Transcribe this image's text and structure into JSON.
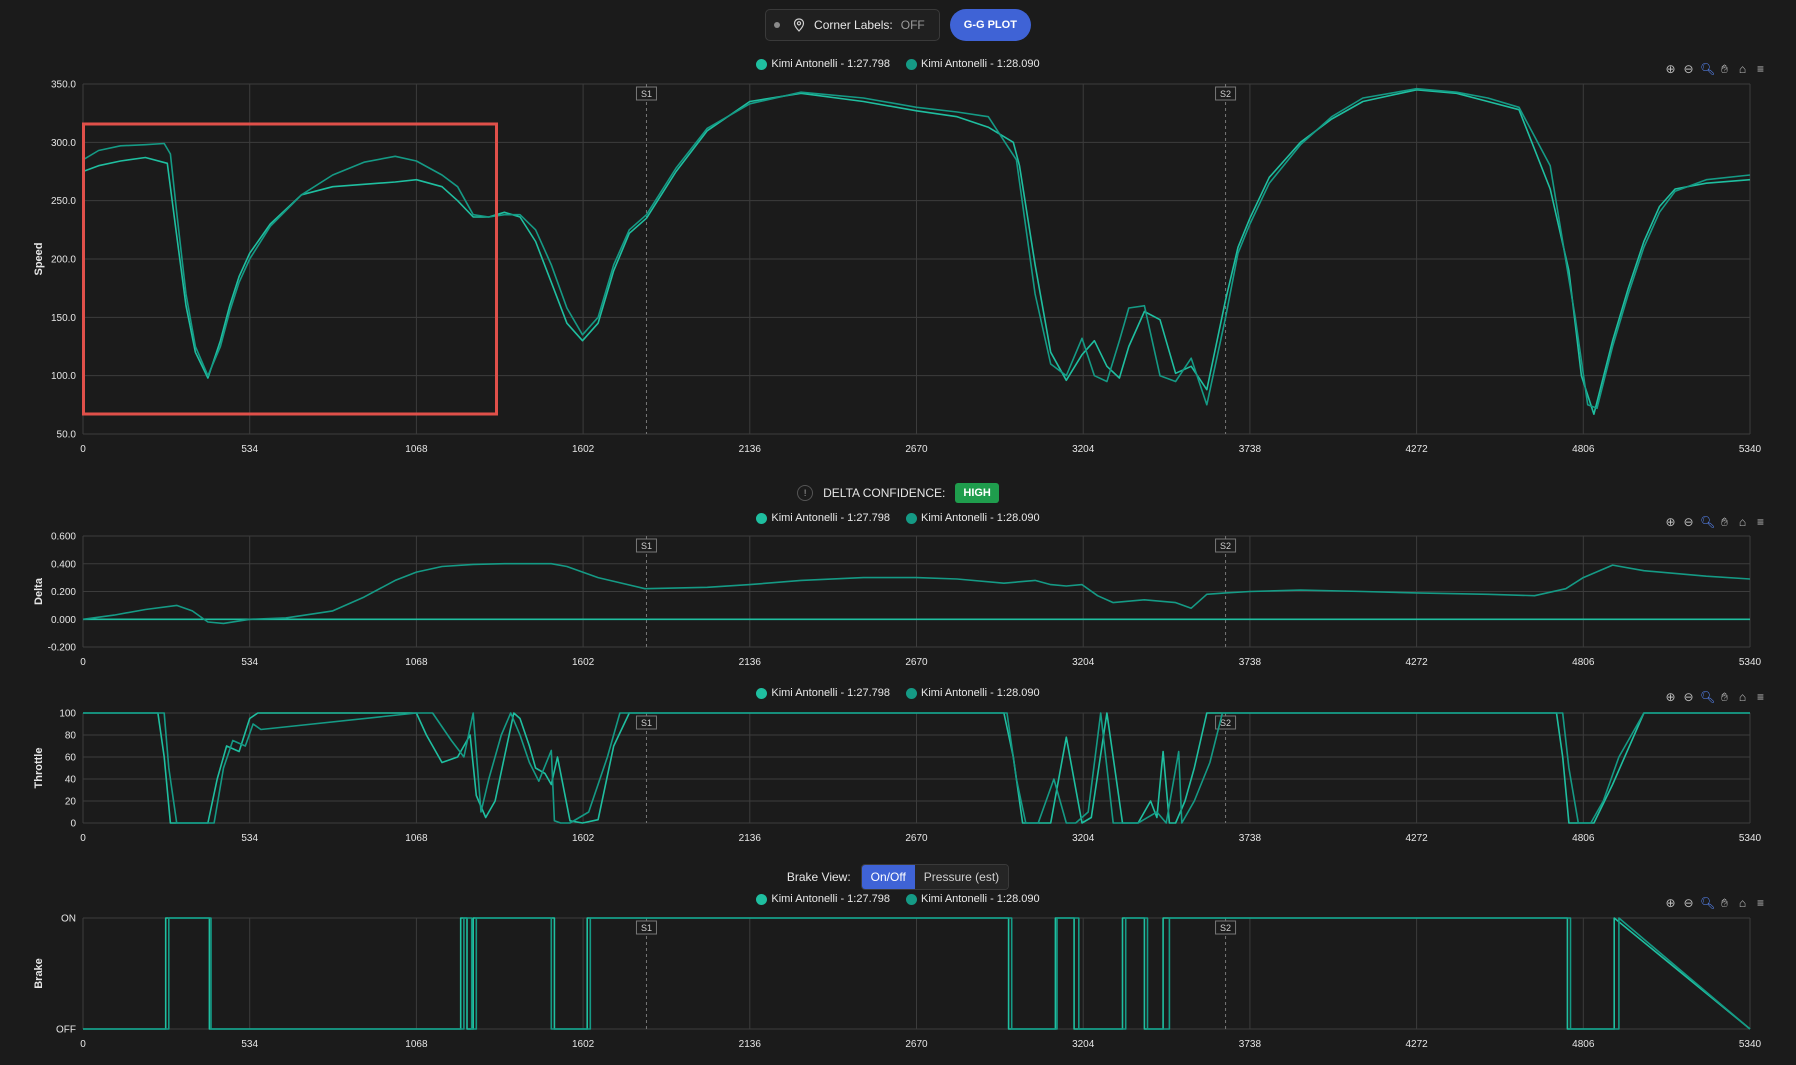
{
  "top_bar": {
    "corner_labels_text": "Corner Labels:",
    "corner_labels_state": "OFF",
    "gg_plot_label": "G-G PLOT"
  },
  "delta_confidence": {
    "label": "DELTA CONFIDENCE:",
    "value": "HIGH"
  },
  "brake_view": {
    "label": "Brake View:",
    "options": [
      "On/Off",
      "Pressure (est)"
    ],
    "selected": "On/Off"
  },
  "colors": {
    "background": "#1b1b1b",
    "series_a": "#1fbfa0",
    "series_b": "#159a85",
    "grid": "#3c3c3c",
    "accent": "#3f63d6",
    "highlight_box": "#e0504a",
    "high_badge": "#1f9d4d"
  },
  "toolbar_icons": [
    "zoom-in-icon",
    "zoom-out-icon",
    "magnifier-icon",
    "pan-hand-icon",
    "home-icon",
    "menu-icon"
  ],
  "chart_data": [
    {
      "type": "line",
      "ylabel": "Speed",
      "ylim": [
        50,
        350
      ],
      "yticks": [
        "50.0",
        "100.0",
        "150.0",
        "200.0",
        "250.0",
        "300.0",
        "350.0"
      ],
      "xticks": [
        "0",
        "534",
        "1068",
        "1602",
        "2136",
        "2670",
        "3204",
        "3738",
        "4272",
        "4806",
        "5340"
      ],
      "xlim": [
        0,
        5340
      ],
      "sectors": [
        {
          "label": "S1",
          "x": 1805
        },
        {
          "label": "S2",
          "x": 3660
        }
      ],
      "legend": [
        "Kimi Antonelli - 1:27.798",
        "Kimi Antonelli - 1:28.090"
      ],
      "series": [
        {
          "name": "Kimi Antonelli - 1:27.798",
          "x": [
            0,
            50,
            120,
            200,
            270,
            300,
            330,
            360,
            400,
            440,
            470,
            500,
            534,
            600,
            700,
            800,
            900,
            1000,
            1068,
            1150,
            1200,
            1250,
            1300,
            1350,
            1400,
            1450,
            1500,
            1550,
            1600,
            1650,
            1700,
            1750,
            1805,
            1900,
            2000,
            2136,
            2300,
            2500,
            2670,
            2800,
            2900,
            2980,
            3000,
            3050,
            3100,
            3150,
            3200,
            3240,
            3280,
            3320,
            3350,
            3400,
            3450,
            3500,
            3550,
            3600,
            3660,
            3700,
            3738,
            3800,
            3900,
            4000,
            4100,
            4272,
            4400,
            4500,
            4600,
            4700,
            4760,
            4800,
            4840,
            4900,
            4950,
            5000,
            5050,
            5100,
            5200,
            5340
          ],
          "y": [
            275,
            280,
            284,
            287,
            282,
            220,
            160,
            120,
            98,
            130,
            160,
            185,
            205,
            230,
            255,
            262,
            264,
            266,
            268,
            262,
            250,
            236,
            236,
            240,
            236,
            215,
            180,
            145,
            130,
            145,
            190,
            222,
            235,
            275,
            310,
            335,
            342,
            335,
            327,
            322,
            313,
            300,
            280,
            195,
            120,
            96,
            118,
            130,
            108,
            98,
            125,
            155,
            148,
            102,
            108,
            88,
            165,
            210,
            235,
            270,
            300,
            320,
            335,
            345,
            342,
            335,
            328,
            260,
            190,
            100,
            67,
            130,
            175,
            215,
            245,
            260,
            265,
            268
          ]
        },
        {
          "name": "Kimi Antonelli - 1:28.090",
          "x": [
            0,
            50,
            120,
            200,
            260,
            280,
            300,
            330,
            360,
            400,
            440,
            470,
            500,
            534,
            600,
            700,
            800,
            900,
            1000,
            1068,
            1150,
            1200,
            1250,
            1300,
            1350,
            1400,
            1450,
            1500,
            1550,
            1600,
            1650,
            1700,
            1750,
            1805,
            1900,
            2000,
            2136,
            2300,
            2500,
            2670,
            2800,
            2900,
            2990,
            3050,
            3100,
            3150,
            3200,
            3240,
            3280,
            3320,
            3350,
            3400,
            3450,
            3500,
            3550,
            3600,
            3660,
            3700,
            3738,
            3800,
            3900,
            4000,
            4100,
            4272,
            4400,
            4500,
            4600,
            4700,
            4780,
            4820,
            4850,
            4900,
            4950,
            5000,
            5050,
            5100,
            5200,
            5340
          ],
          "y": [
            285,
            293,
            297,
            298,
            299,
            290,
            240,
            170,
            125,
            100,
            125,
            155,
            180,
            200,
            228,
            255,
            272,
            283,
            288,
            284,
            272,
            262,
            238,
            236,
            238,
            238,
            225,
            195,
            158,
            135,
            150,
            195,
            225,
            238,
            278,
            312,
            333,
            343,
            338,
            330,
            326,
            322,
            285,
            170,
            110,
            100,
            132,
            100,
            95,
            130,
            158,
            160,
            100,
            95,
            115,
            75,
            150,
            205,
            230,
            265,
            298,
            322,
            338,
            346,
            343,
            338,
            330,
            280,
            150,
            75,
            72,
            125,
            170,
            210,
            240,
            258,
            268,
            272
          ]
        }
      ]
    },
    {
      "type": "line",
      "ylabel": "Delta",
      "ylim": [
        -0.2,
        0.6
      ],
      "yticks": [
        "-0.200",
        "0.000",
        "0.200",
        "0.400",
        "0.600"
      ],
      "xticks": [
        "0",
        "534",
        "1068",
        "1602",
        "2136",
        "2670",
        "3204",
        "3738",
        "4272",
        "4806",
        "5340"
      ],
      "xlim": [
        0,
        5340
      ],
      "sectors": [
        {
          "label": "S1",
          "x": 1805
        },
        {
          "label": "S2",
          "x": 3660
        }
      ],
      "legend": [
        "Kimi Antonelli - 1:27.798",
        "Kimi Antonelli - 1:28.090"
      ],
      "series": [
        {
          "name": "Kimi Antonelli - 1:27.798",
          "x": [
            0,
            5340
          ],
          "y": [
            0,
            0
          ]
        },
        {
          "name": "Kimi Antonelli - 1:28.090",
          "x": [
            0,
            100,
            200,
            300,
            350,
            400,
            450,
            534,
            650,
            800,
            900,
            1000,
            1068,
            1150,
            1250,
            1350,
            1450,
            1500,
            1550,
            1650,
            1800,
            2000,
            2136,
            2300,
            2500,
            2670,
            2800,
            2950,
            3050,
            3100,
            3150,
            3200,
            3250,
            3300,
            3400,
            3500,
            3550,
            3600,
            3660,
            3738,
            3900,
            4100,
            4272,
            4500,
            4650,
            4750,
            4806,
            4900,
            5000,
            5200,
            5340
          ],
          "y": [
            0,
            0.03,
            0.07,
            0.1,
            0.06,
            -0.02,
            -0.03,
            0.0,
            0.01,
            0.06,
            0.16,
            0.28,
            0.34,
            0.38,
            0.395,
            0.4,
            0.4,
            0.4,
            0.38,
            0.3,
            0.22,
            0.23,
            0.25,
            0.28,
            0.3,
            0.3,
            0.29,
            0.26,
            0.28,
            0.25,
            0.24,
            0.25,
            0.17,
            0.12,
            0.14,
            0.12,
            0.08,
            0.18,
            0.19,
            0.2,
            0.21,
            0.2,
            0.19,
            0.18,
            0.17,
            0.22,
            0.3,
            0.39,
            0.35,
            0.31,
            0.29
          ]
        }
      ]
    },
    {
      "type": "line",
      "ylabel": "Throttle",
      "ylim": [
        0,
        100
      ],
      "yticks": [
        "0",
        "20",
        "40",
        "60",
        "80",
        "100"
      ],
      "xticks": [
        "0",
        "534",
        "1068",
        "1602",
        "2136",
        "2670",
        "3204",
        "3738",
        "4272",
        "4806",
        "5340"
      ],
      "xlim": [
        0,
        5340
      ],
      "sectors": [
        {
          "label": "S1",
          "x": 1805
        },
        {
          "label": "S2",
          "x": 3660
        }
      ],
      "legend": [
        "Kimi Antonelli - 1:27.798",
        "Kimi Antonelli - 1:28.090"
      ],
      "series": [
        {
          "name": "Kimi Antonelli - 1:27.798",
          "x": [
            0,
            240,
            260,
            280,
            400,
            430,
            460,
            500,
            534,
            560,
            1068,
            1100,
            1150,
            1200,
            1240,
            1260,
            1290,
            1320,
            1350,
            1380,
            1400,
            1430,
            1450,
            1480,
            1500,
            1520,
            1560,
            1600,
            1650,
            1700,
            1750,
            2950,
            2980,
            3010,
            3050,
            3100,
            3150,
            3200,
            3230,
            3280,
            3330,
            3380,
            3420,
            3440,
            3460,
            3480,
            3500,
            3530,
            3560,
            3600,
            3660,
            4720,
            4740,
            4760,
            4800,
            4840,
            4900,
            5000,
            5340
          ],
          "y": [
            100,
            100,
            60,
            0,
            0,
            40,
            70,
            65,
            95,
            100,
            100,
            80,
            55,
            60,
            80,
            25,
            5,
            20,
            60,
            100,
            95,
            70,
            50,
            45,
            35,
            60,
            2,
            0,
            3,
            70,
            100,
            100,
            60,
            0,
            0,
            0,
            78,
            0,
            5,
            100,
            0,
            0,
            20,
            5,
            65,
            0,
            0,
            20,
            50,
            100,
            100,
            100,
            60,
            0,
            0,
            0,
            35,
            100,
            100
          ]
        },
        {
          "name": "Kimi Antonelli - 1:28.090",
          "x": [
            0,
            260,
            275,
            300,
            420,
            450,
            480,
            520,
            545,
            570,
            1068,
            1120,
            1180,
            1220,
            1250,
            1275,
            1300,
            1340,
            1370,
            1400,
            1430,
            1460,
            1500,
            1510,
            1530,
            1560,
            1620,
            1680,
            1720,
            1780,
            2960,
            2990,
            3020,
            3060,
            3110,
            3150,
            3180,
            3220,
            3260,
            3300,
            3340,
            3380,
            3440,
            3470,
            3510,
            3520,
            3560,
            3610,
            3650,
            4740,
            4760,
            4790,
            4830,
            4870,
            4920,
            5000,
            5340
          ],
          "y": [
            100,
            100,
            50,
            0,
            0,
            50,
            75,
            70,
            90,
            85,
            100,
            100,
            75,
            60,
            100,
            10,
            40,
            80,
            100,
            80,
            55,
            38,
            66,
            2,
            0,
            0,
            10,
            60,
            100,
            100,
            100,
            40,
            0,
            0,
            40,
            0,
            0,
            10,
            100,
            0,
            0,
            0,
            10,
            0,
            65,
            0,
            20,
            55,
            100,
            100,
            50,
            0,
            0,
            20,
            60,
            100,
            100
          ]
        }
      ]
    },
    {
      "type": "line",
      "ylabel": "Brake",
      "ylim": [
        0,
        1
      ],
      "yticks": [
        "OFF",
        "ON"
      ],
      "xticks": [
        "0",
        "534",
        "1068",
        "1602",
        "2136",
        "2670",
        "3204",
        "3738",
        "4272",
        "4806",
        "5340"
      ],
      "xlim": [
        0,
        5340
      ],
      "sectors": [
        {
          "label": "S1",
          "x": 1805
        },
        {
          "label": "S2",
          "x": 3660
        }
      ],
      "legend": [
        "Kimi Antonelli - 1:27.798",
        "Kimi Antonelli - 1:28.090"
      ],
      "series": [
        {
          "name": "Kimi Antonelli - 1:27.798",
          "x": [
            0,
            265,
            265,
            405,
            405,
            1210,
            1210,
            1230,
            1230,
            1250,
            1250,
            1510,
            1510,
            1615,
            1615,
            2965,
            2965,
            3115,
            3115,
            3175,
            3175,
            3330,
            3330,
            3400,
            3400,
            3460,
            3460,
            4755,
            4755,
            4905,
            4905,
            5340
          ],
          "y": [
            0,
            0,
            1,
            1,
            0,
            0,
            1,
            1,
            0,
            0,
            1,
            1,
            0,
            0,
            1,
            1,
            0,
            0,
            1,
            1,
            0,
            0,
            1,
            1,
            0,
            0,
            1,
            1,
            0,
            0,
            1,
            0
          ]
        },
        {
          "name": "Kimi Antonelli - 1:28.090",
          "x": [
            0,
            275,
            275,
            410,
            410,
            1220,
            1220,
            1245,
            1245,
            1260,
            1260,
            1500,
            1500,
            1625,
            1625,
            2975,
            2975,
            3120,
            3120,
            3190,
            3190,
            3340,
            3340,
            3410,
            3410,
            3480,
            3480,
            4765,
            4765,
            4920,
            4920,
            5340
          ],
          "y": [
            0,
            0,
            1,
            1,
            0,
            0,
            1,
            1,
            0,
            0,
            1,
            1,
            0,
            0,
            1,
            1,
            0,
            0,
            1,
            1,
            0,
            0,
            1,
            1,
            0,
            0,
            1,
            1,
            0,
            0,
            1,
            0
          ]
        }
      ]
    }
  ]
}
